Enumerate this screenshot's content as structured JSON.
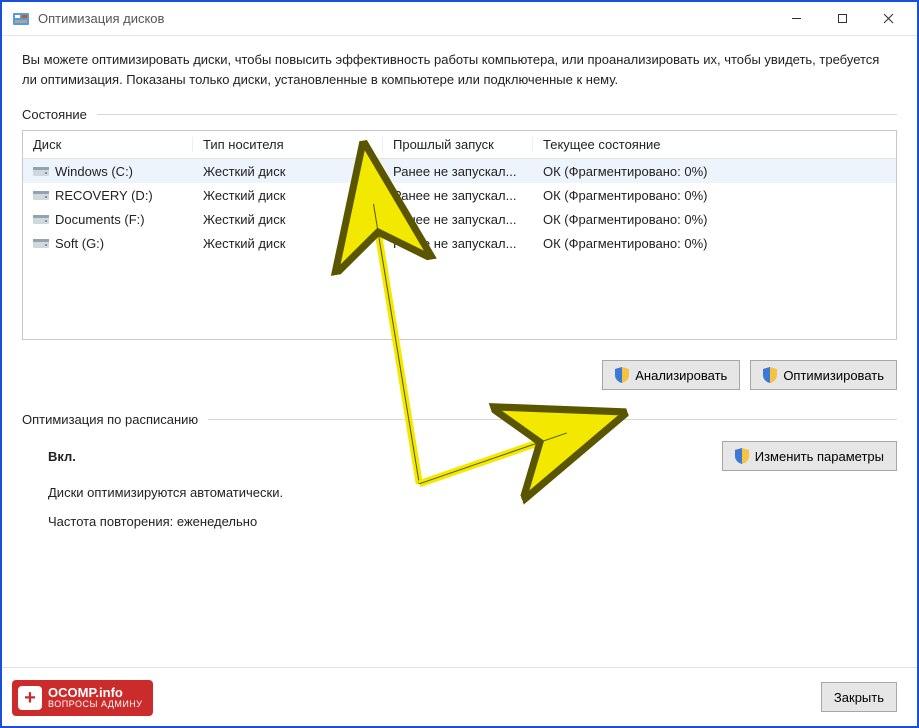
{
  "titlebar": {
    "title": "Оптимизация дисков"
  },
  "intro": "Вы можете оптимизировать диски, чтобы повысить эффективность работы компьютера, или проанализировать их, чтобы увидеть, требуется ли оптимизация. Показаны только диски, установленные в компьютере или подключенные к нему.",
  "status_label": "Состояние",
  "table": {
    "headers": {
      "disk": "Диск",
      "media": "Тип носителя",
      "last_run": "Прошлый запуск",
      "status": "Текущее состояние"
    },
    "rows": [
      {
        "name": "Windows (C:)",
        "media": "Жесткий диск",
        "last_run": "Ранее не запускал...",
        "status": "ОК (Фрагментировано: 0%)",
        "selected": true
      },
      {
        "name": "RECOVERY (D:)",
        "media": "Жесткий диск",
        "last_run": "Ранее не запускал...",
        "status": "ОК (Фрагментировано: 0%)",
        "selected": false
      },
      {
        "name": "Documents (F:)",
        "media": "Жесткий диск",
        "last_run": "Ранее не запускал...",
        "status": "ОК (Фрагментировано: 0%)",
        "selected": false
      },
      {
        "name": "Soft (G:)",
        "media": "Жесткий диск",
        "last_run": "Ранее не запускал...",
        "status": "ОК (Фрагментировано: 0%)",
        "selected": false
      }
    ]
  },
  "buttons": {
    "analyze": "Анализировать",
    "optimize": "Оптимизировать",
    "change_settings": "Изменить параметры",
    "close": "Закрыть"
  },
  "schedule": {
    "section_label": "Оптимизация по расписанию",
    "on_label": "Вкл.",
    "auto_text": "Диски оптимизируются автоматически.",
    "frequency_text": "Частота повторения: еженедельно"
  },
  "badge": {
    "main": "OCOMP.info",
    "sub": "ВОПРОСЫ АДМИНУ"
  }
}
